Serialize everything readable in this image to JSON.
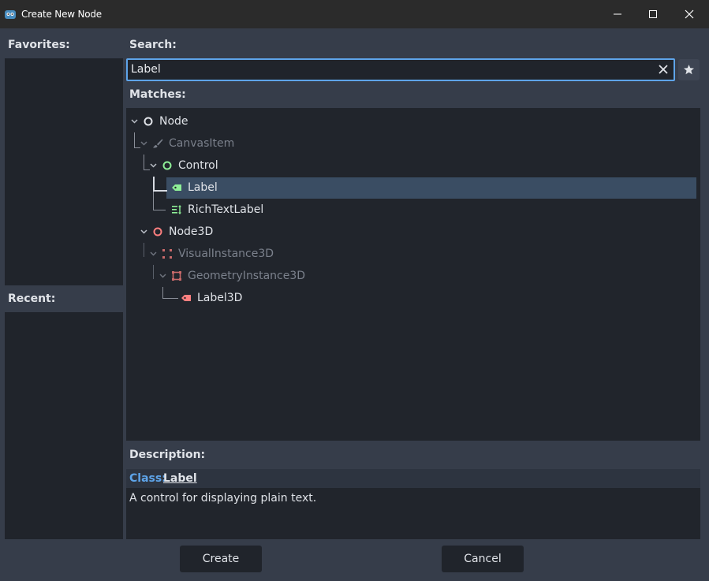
{
  "window": {
    "title": "Create New Node"
  },
  "favorites": {
    "label": "Favorites:"
  },
  "recent": {
    "label": "Recent:"
  },
  "search": {
    "label": "Search:",
    "value": "Label",
    "placeholder": ""
  },
  "matches": {
    "label": "Matches:",
    "items": [
      {
        "label": "Node",
        "icon": "node-circle-icon",
        "color": "#e0e3e8",
        "dim": false
      },
      {
        "label": "CanvasItem",
        "icon": "brush-icon",
        "color": "#7b818c",
        "dim": true
      },
      {
        "label": "Control",
        "icon": "control-circle-icon",
        "color": "#8eef97",
        "dim": false
      },
      {
        "label": "Label",
        "icon": "label-tag-icon",
        "color": "#8eef97",
        "dim": false,
        "selected": true
      },
      {
        "label": "RichTextLabel",
        "icon": "rich-text-icon",
        "color": "#8eef97",
        "dim": false
      },
      {
        "label": "Node3D",
        "icon": "node3d-circle-icon",
        "color": "#fc7f7f",
        "dim": false
      },
      {
        "label": "VisualInstance3D",
        "icon": "visual-instance-icon",
        "color": "#fc7f7f",
        "dim": true
      },
      {
        "label": "GeometryInstance3D",
        "icon": "geometry-instance-icon",
        "color": "#fc7f7f",
        "dim": true
      },
      {
        "label": "Label3D",
        "icon": "label3d-tag-icon",
        "color": "#fc7f7f",
        "dim": false
      }
    ]
  },
  "description": {
    "label": "Description:",
    "class_prefix": "Class:",
    "class_name": "Label",
    "text": "A control for displaying plain text."
  },
  "buttons": {
    "create": "Create",
    "cancel": "Cancel"
  },
  "colors": {
    "accent": "#5ea4e9",
    "selected": "#3a4d63",
    "control": "#8eef97",
    "node3d": "#fc7f7f"
  }
}
